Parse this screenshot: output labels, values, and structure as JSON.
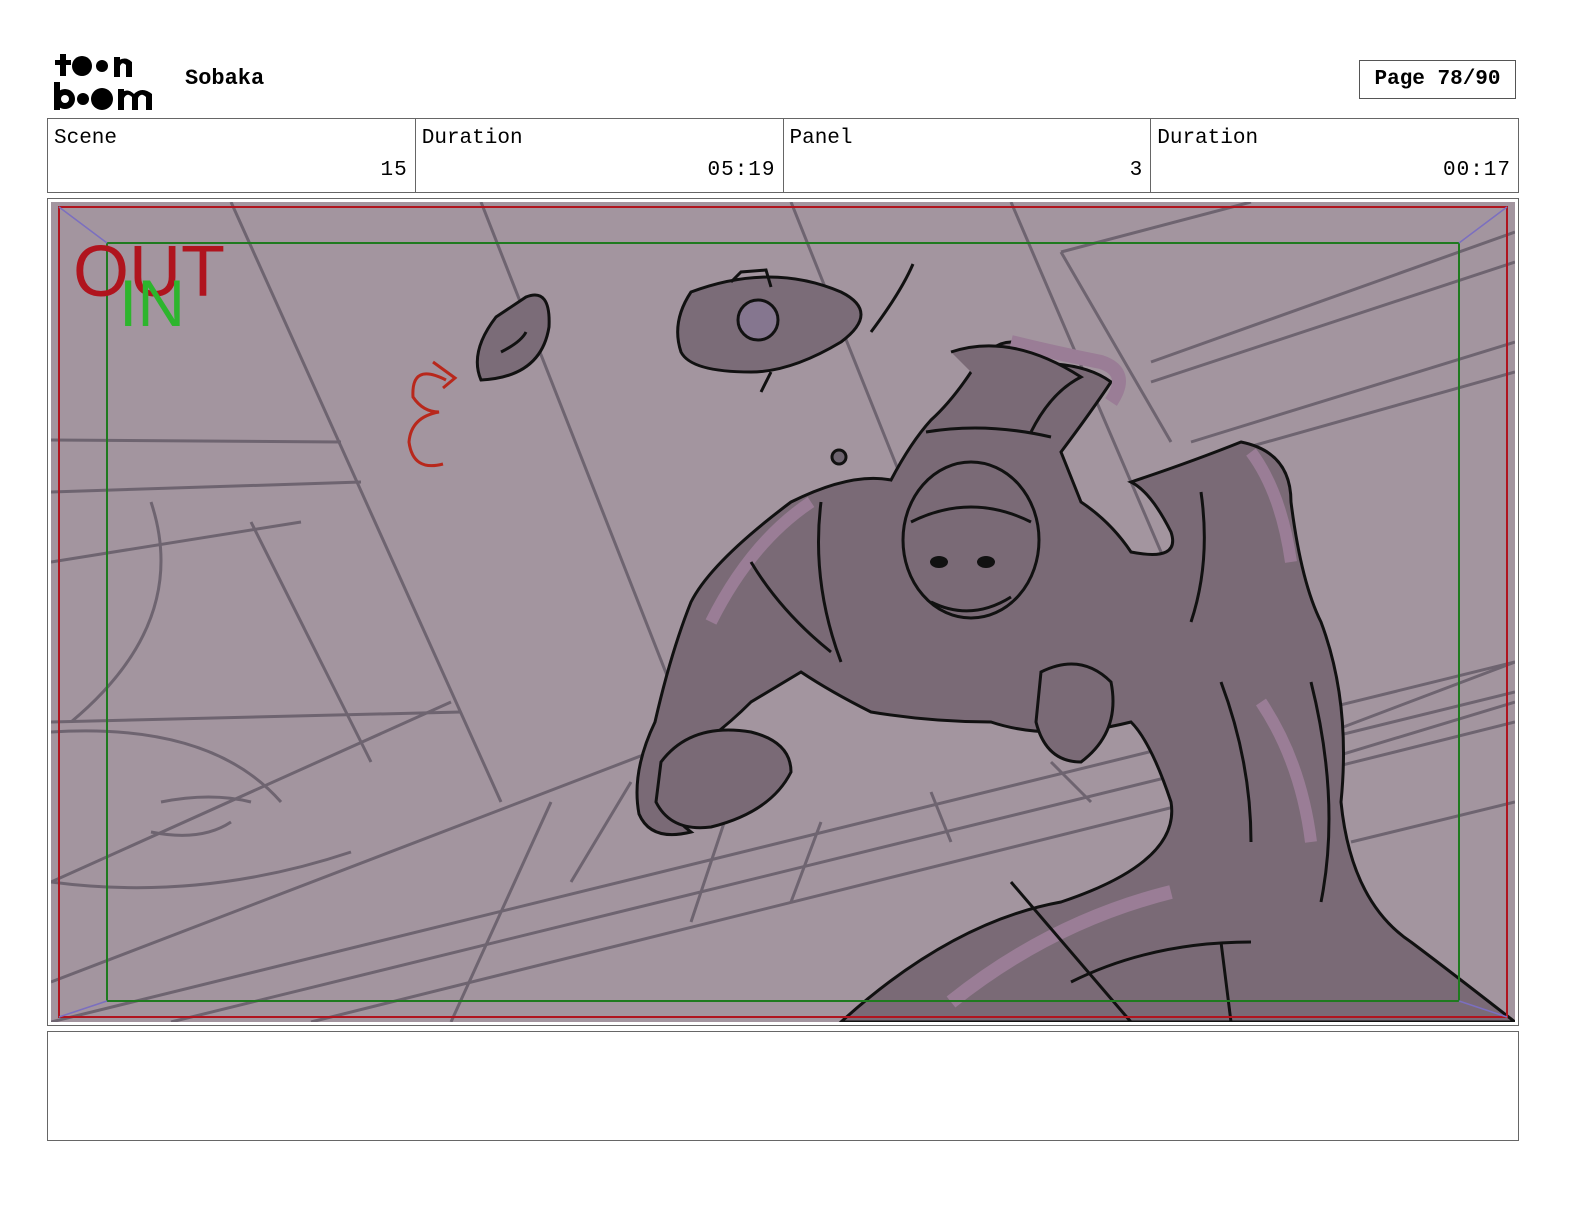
{
  "header": {
    "logo_top": "toon",
    "logo_bottom": "boom",
    "project_title": "Sobaka",
    "page_indicator": "Page 78/90"
  },
  "info": {
    "scene_label": "Scene",
    "scene_value": "15",
    "scene_duration_label": "Duration",
    "scene_duration_value": "05:19",
    "panel_label": "Panel",
    "panel_value": "3",
    "panel_duration_label": "Duration",
    "panel_duration_value": "00:17"
  },
  "panel": {
    "field_out_label": "OUT",
    "field_in_label": "IN"
  },
  "notes": {
    "text": ""
  },
  "colors": {
    "background_tint": "#a3959f",
    "shadow_tone": "#7a6a76",
    "highlight_tone": "#9a7d96",
    "out_frame": "#b0141e",
    "in_frame": "#1f7a1f",
    "in_text": "#2db52d",
    "annotation_red": "#b8281c"
  }
}
